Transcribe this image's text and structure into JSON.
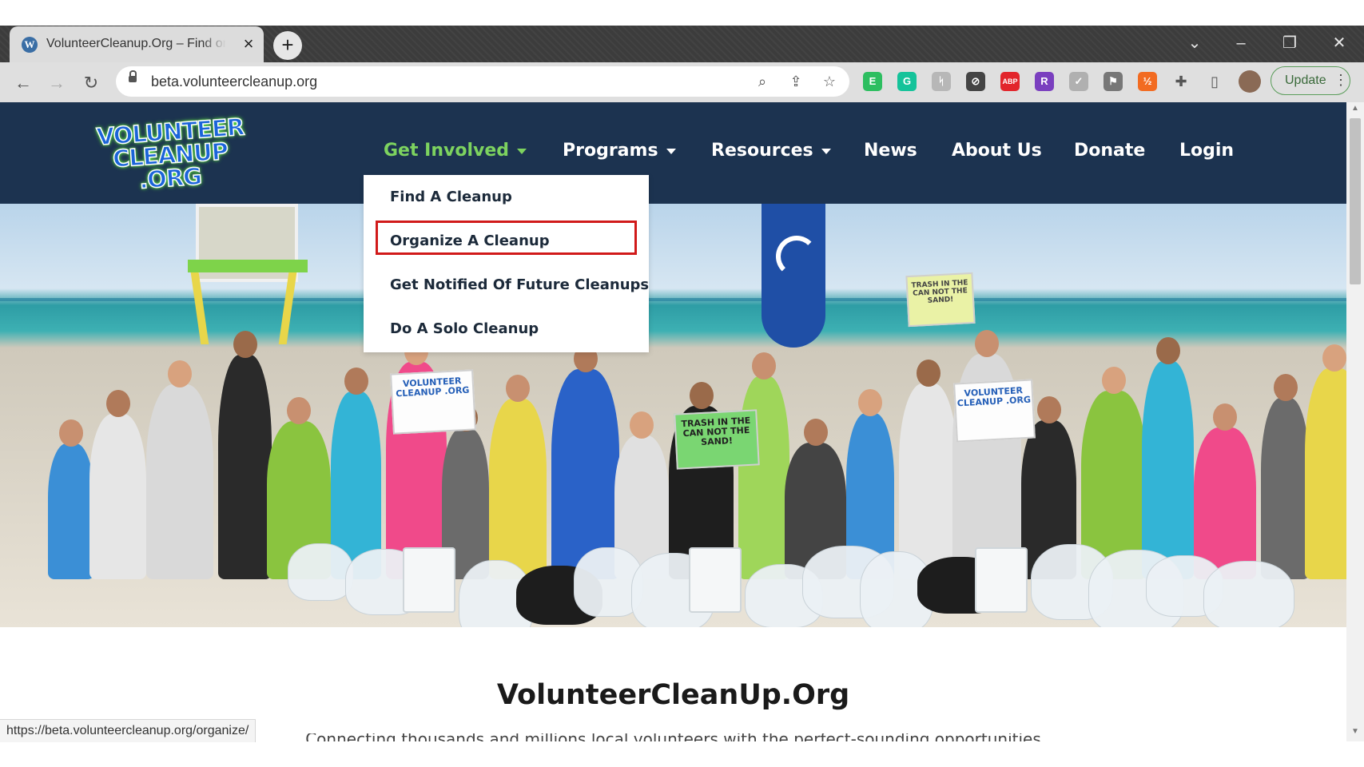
{
  "browser": {
    "tab": {
      "title": "VolunteerCleanup.Org – Find or Organize a Cleanup",
      "favicon": "wordpress-icon"
    },
    "new_tab_glyph": "+",
    "url": "beta.volunteercleanup.org",
    "update_label": "Update",
    "extensions": [
      {
        "name": "evernote-extension-icon",
        "glyph": "E",
        "color": "#2dbe60"
      },
      {
        "name": "grammarly-extension-icon",
        "glyph": "G",
        "color": "#15c39a"
      },
      {
        "name": "ghost-extension-icon",
        "glyph": "ᛋ",
        "color": "#b7b7b7"
      },
      {
        "name": "eye-off-extension-icon",
        "glyph": "⊘",
        "color": "#444444"
      },
      {
        "name": "adblock-plus-extension-icon",
        "glyph": "ABP",
        "color": "#e2252b"
      },
      {
        "name": "r-extension-icon",
        "glyph": "R",
        "color": "#7a3fbf"
      },
      {
        "name": "check-extension-icon",
        "glyph": "✓",
        "color": "#b0b0b0"
      },
      {
        "name": "puzzle-flag-extension-icon",
        "glyph": "⚑",
        "color": "#777777"
      },
      {
        "name": "orange-extension-icon",
        "glyph": "½",
        "color": "#f26b21"
      }
    ]
  },
  "site": {
    "logo_lines": [
      "VOLUNTEER",
      "CLEANUP",
      ".ORG"
    ],
    "nav": [
      {
        "label": "Get Involved",
        "has_caret": true,
        "active": true
      },
      {
        "label": "Programs",
        "has_caret": true,
        "active": false
      },
      {
        "label": "Resources",
        "has_caret": true,
        "active": false
      },
      {
        "label": "News",
        "has_caret": false,
        "active": false
      },
      {
        "label": "About Us",
        "has_caret": false,
        "active": false
      },
      {
        "label": "Donate",
        "has_caret": false,
        "active": false
      },
      {
        "label": "Login",
        "has_caret": false,
        "active": false
      }
    ],
    "dropdown": [
      {
        "label": "Find A Cleanup",
        "highlighted": false
      },
      {
        "label": "Organize A Cleanup",
        "highlighted": true
      },
      {
        "label": "Get Notified Of Future Cleanups",
        "highlighted": false
      },
      {
        "label": "Do A Solo Cleanup",
        "highlighted": false
      }
    ],
    "hero_signs": [
      "VOLUNTEER CLEANUP .ORG",
      "TRASH IN THE CAN NOT THE SAND!",
      "VOLUNTEER CLEANUP .ORG",
      "TRASH IN THE CAN NOT THE SAND!"
    ],
    "section_title": "VolunteerCleanUp.Org",
    "section_subtitle": "Connecting thousands and millions local volunteers with the perfect-sounding opportunities"
  },
  "status_url": "https://beta.volunteercleanup.org/organize/",
  "colors": {
    "nav_bg": "#1c3350",
    "nav_active": "#7dd35f",
    "highlight_border": "#d11a1a"
  }
}
